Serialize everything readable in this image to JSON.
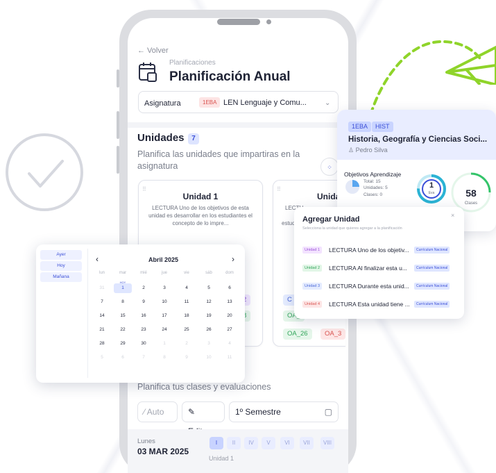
{
  "app": {
    "back_label": "← Volver",
    "breadcrumb": "Planificaciones",
    "title": "Planificación Anual"
  },
  "subject": {
    "label": "Asignatura",
    "tag": "1EBA",
    "value": "LEN  Lenguaje y Comu..."
  },
  "units": {
    "title": "Unidades",
    "count": "7",
    "description": "Planifica las unidades que impartiras en la asignatura",
    "cards": [
      {
        "title": "Unidad 1",
        "text": "LECTURA Uno de los objetivos de esta unidad es desarrollar en los estudiantes el concepto de lo impre...",
        "chips_visible": [
          "2",
          "8"
        ]
      },
      {
        "title": "Unida",
        "text_lines": [
          "LECTU",
          "e",
          "estudi"
        ],
        "chips_visible": [
          "C",
          "OA_",
          "OA_26",
          "OA_3"
        ]
      }
    ]
  },
  "planning": {
    "description": "Planifica tus clases y evaluaciones",
    "auto_label": "Auto",
    "edit_label": "Editar",
    "semester_label": "1º Semestre"
  },
  "bottom": {
    "day": "Lunes",
    "date": "03 MAR 2025",
    "unit_label": "Unidad 1",
    "romans": [
      "I",
      "II",
      "IV",
      "V",
      "VI",
      "VII",
      "VIII"
    ]
  },
  "course_card": {
    "tags": [
      "1EBA",
      "HIST"
    ],
    "title": "Historia, Geografía y Ciencias Soci...",
    "teacher": "Pedro Silva",
    "oa_label": "Objetivos Aprendizaje",
    "stats": [
      "Total: 15",
      "Unidades: 5",
      "Clases: 0"
    ],
    "ring_small_value": "1",
    "ring_small_label": "Eva",
    "ring_big_value": "58",
    "ring_big_label": "Clases"
  },
  "modal": {
    "title": "Agregar Unidad",
    "close": "×",
    "subtitle": "Selecciona la unidad que quieres agregar a la planificación",
    "rows": [
      {
        "tag": "Unidad 1",
        "text": "LECTURA Uno de los objetiv...",
        "badge": "Currículum Nacional",
        "color": "#f3e3ff",
        "fg": "#9b52d8"
      },
      {
        "tag": "Unidad 2",
        "text": "LECTURA Al finalizar esta u...",
        "badge": "Currículum Nacional",
        "color": "#e2f6e7",
        "fg": "#31a55a"
      },
      {
        "tag": "Unidad 3",
        "text": "LECTURA Durante esta unid...",
        "badge": "Currículum Nacional",
        "color": "#e5ecff",
        "fg": "#4a68d8"
      },
      {
        "tag": "Unidad 4",
        "text": "LECTURA Esta unidad tiene ...",
        "badge": "Currículum Nacional",
        "color": "#fde6e6",
        "fg": "#d9534f"
      }
    ]
  },
  "calendar": {
    "quick": [
      "Ayer",
      "Hoy",
      "Mañana"
    ],
    "month": "Abril 2025",
    "prev": "‹",
    "next": "›",
    "weekdays": [
      "lun",
      "mar",
      "mié",
      "jue",
      "vie",
      "sáb",
      "dom"
    ],
    "today_label": "HOY",
    "weeks": [
      [
        "31",
        "1",
        "2",
        "3",
        "4",
        "5",
        "6"
      ],
      [
        "7",
        "8",
        "9",
        "10",
        "11",
        "12",
        "13"
      ],
      [
        "14",
        "15",
        "16",
        "17",
        "18",
        "19",
        "20"
      ],
      [
        "21",
        "22",
        "23",
        "24",
        "25",
        "26",
        "27"
      ],
      [
        "28",
        "29",
        "30",
        "1",
        "2",
        "3",
        "4"
      ],
      [
        "5",
        "6",
        "7",
        "8",
        "9",
        "10",
        "11"
      ]
    ]
  },
  "colors": {
    "accent": "#3b4fd8",
    "brand_green": "#7ed321"
  }
}
